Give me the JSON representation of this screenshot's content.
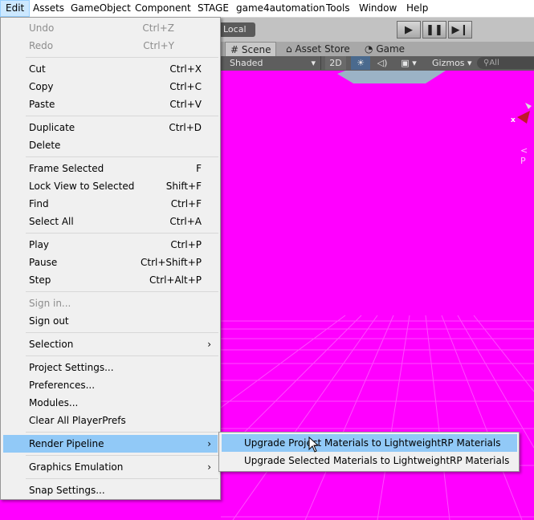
{
  "menubar": {
    "items": [
      {
        "label": "Edit",
        "active": true
      },
      {
        "label": "Assets"
      },
      {
        "label": "GameObject"
      },
      {
        "label": "Component"
      },
      {
        "label": "STAGE"
      },
      {
        "label": "game4automation"
      },
      {
        "label": "Tools"
      },
      {
        "label": "Window"
      },
      {
        "label": "Help"
      }
    ]
  },
  "toolbar": {
    "pivot_label": "Local",
    "play_icon": "play-icon",
    "pause_icon": "pause-icon",
    "step_icon": "step-icon"
  },
  "tabs": {
    "scene": "Scene",
    "asset_store": "Asset Store",
    "game": "Game"
  },
  "scene_toolbar": {
    "shading": "Shaded",
    "mode_2d": "2D",
    "gizmos": "Gizmos",
    "search_placeholder": "All"
  },
  "scene_view": {
    "background_color": "#ff00ff",
    "axis_x_label": "x",
    "persp_label": "< P"
  },
  "edit_menu": {
    "undo": {
      "label": "Undo",
      "shortcut": "Ctrl+Z",
      "disabled": true
    },
    "redo": {
      "label": "Redo",
      "shortcut": "Ctrl+Y",
      "disabled": true
    },
    "cut": {
      "label": "Cut",
      "shortcut": "Ctrl+X"
    },
    "copy": {
      "label": "Copy",
      "shortcut": "Ctrl+C"
    },
    "paste": {
      "label": "Paste",
      "shortcut": "Ctrl+V"
    },
    "duplicate": {
      "label": "Duplicate",
      "shortcut": "Ctrl+D"
    },
    "delete": {
      "label": "Delete"
    },
    "frame_selected": {
      "label": "Frame Selected",
      "shortcut": "F"
    },
    "lock_view": {
      "label": "Lock View to Selected",
      "shortcut": "Shift+F"
    },
    "find": {
      "label": "Find",
      "shortcut": "Ctrl+F"
    },
    "select_all": {
      "label": "Select All",
      "shortcut": "Ctrl+A"
    },
    "play": {
      "label": "Play",
      "shortcut": "Ctrl+P"
    },
    "pause": {
      "label": "Pause",
      "shortcut": "Ctrl+Shift+P"
    },
    "step": {
      "label": "Step",
      "shortcut": "Ctrl+Alt+P"
    },
    "sign_in": {
      "label": "Sign in...",
      "disabled": true
    },
    "sign_out": {
      "label": "Sign out"
    },
    "selection": {
      "label": "Selection",
      "submenu": true
    },
    "project_settings": {
      "label": "Project Settings..."
    },
    "preferences": {
      "label": "Preferences..."
    },
    "modules": {
      "label": "Modules..."
    },
    "clear_playerprefs": {
      "label": "Clear All PlayerPrefs"
    },
    "render_pipeline": {
      "label": "Render Pipeline",
      "submenu": true,
      "highlighted": true
    },
    "graphics_emulation": {
      "label": "Graphics Emulation",
      "submenu": true
    },
    "snap_settings": {
      "label": "Snap Settings..."
    }
  },
  "render_pipeline_submenu": {
    "upgrade_project": {
      "label": "Upgrade Project Materials to LightweightRP Materials",
      "highlighted": true
    },
    "upgrade_selected": {
      "label": "Upgrade Selected Materials to LightweightRP Materials"
    }
  },
  "colors": {
    "menu_bg": "#f0f0f0",
    "highlight": "#91c9f7",
    "disabled_text": "#8d8d8d",
    "active_menubar": "#cce8ff"
  }
}
